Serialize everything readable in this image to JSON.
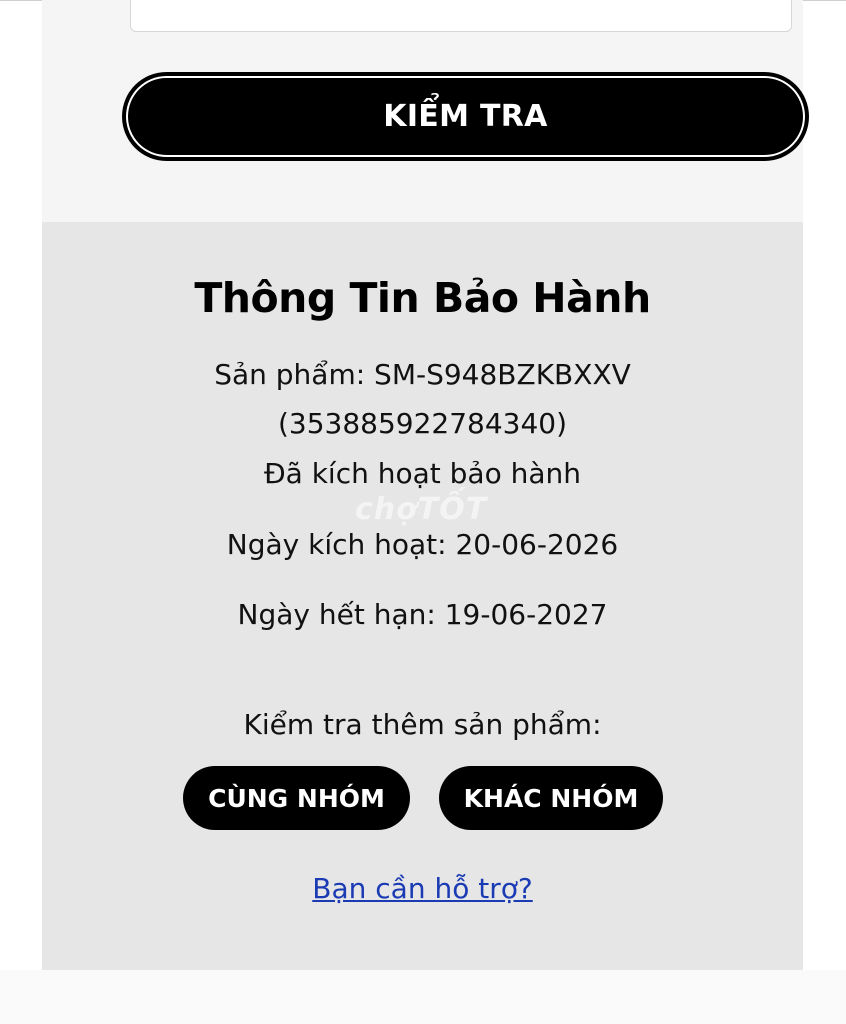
{
  "form": {
    "check_button_label": "KIỂM TRA"
  },
  "warranty": {
    "title": "Thông Tin Bảo Hành",
    "product_line": "Sản phẩm: SM-S948BZKBXXV",
    "imei_line": "(353885922784340)",
    "status_line": "Đã kích hoạt bảo hành",
    "activation_line": "Ngày kích hoạt: 20-06-2026",
    "expiry_line": "Ngày hết hạn: 19-06-2027",
    "more_prompt": "Kiểm tra thêm sản phẩm:",
    "same_group_label": "CÙNG NHÓM",
    "other_group_label": "KHÁC NHÓM",
    "support_link_label": "Bạn cần hỗ trợ?"
  },
  "watermark": {
    "text": "chợTỐT"
  }
}
